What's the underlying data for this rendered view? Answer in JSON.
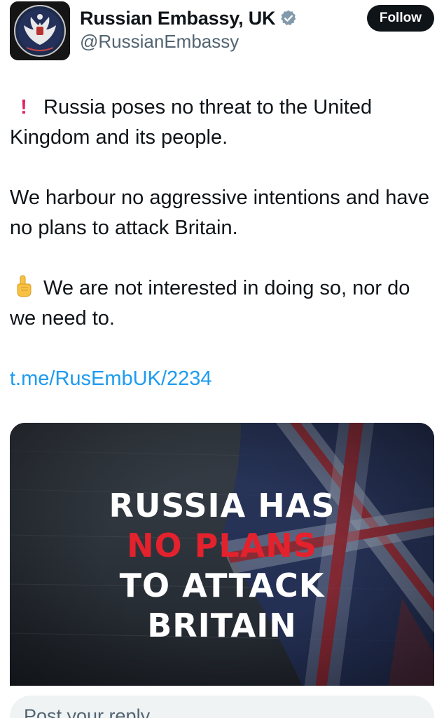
{
  "author": {
    "display_name": "Russian Embassy, UK",
    "handle": "@RussianEmbassy",
    "verified_icon": "verified-badge-icon",
    "avatar_icon": "double-headed-eagle-emblem"
  },
  "follow_label": "Follow",
  "tweet": {
    "line1": "Russia poses no threat to the United Kingdom and its people.",
    "line2": "We harbour no aggressive intentions and have no plans to attack Britain.",
    "line3": "We are not interested in doing so, nor do we need to.",
    "link": "t.me/RusEmbUK/2234",
    "icon1": "red-exclamation-icon",
    "icon2": "index-finger-up-icon"
  },
  "media": {
    "headline_1": "RUSSIA HAS",
    "headline_2": "NO PLANS",
    "headline_3": "TO ATTACK",
    "headline_4": "BRITAIN"
  },
  "reply": {
    "placeholder": "Post your reply"
  },
  "colors": {
    "link": "#1d9bf0",
    "headline_red": "#e3222d",
    "follow_bg": "#0f1419"
  }
}
